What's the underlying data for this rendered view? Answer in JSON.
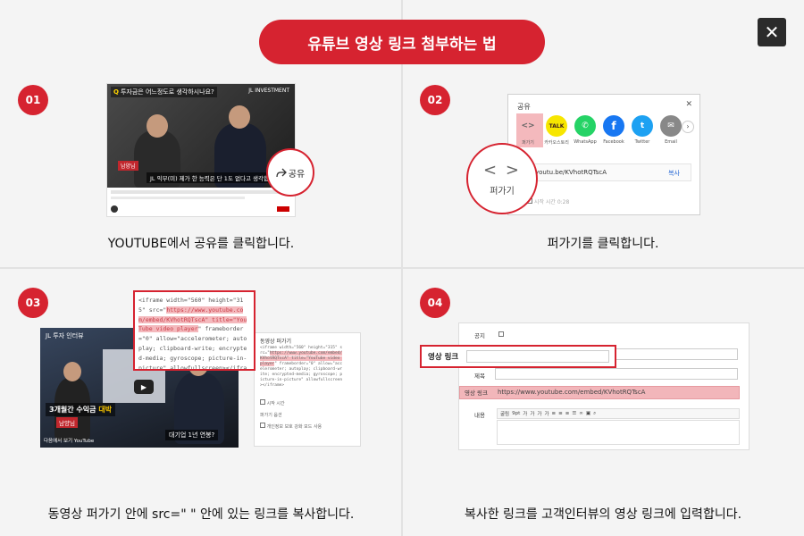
{
  "header": {
    "title": "유튜브 영상 링크 첨부하는 법"
  },
  "close_glyph": "✕",
  "steps": [
    {
      "num": "01",
      "caption": "YOUTUBE에서 공유를 클릭합니다."
    },
    {
      "num": "02",
      "caption": "퍼가기를 클릭합니다."
    },
    {
      "num": "03",
      "caption": "동영상 퍼가기 안에 src=\" \" 안에 있는 링크를 복사합니다."
    },
    {
      "num": "04",
      "caption": "복사한 링크를 고객인터뷰의 영상 링크에 입력합니다."
    }
  ],
  "step1": {
    "video_question": "투자금은 어느정도로 생각하시나요?",
    "video_brand": "JL INVESTMENT",
    "video_tag": "남양님",
    "video_subtitle": "JL 익부(미) 제가 한 능력은 단 1도 없다고 생각합니다.",
    "share_label": "공유",
    "share_icon": "share-arrow-icon"
  },
  "step2": {
    "dialog_title": "공유",
    "apps": [
      {
        "name": "퍼가기",
        "glyph": "<>",
        "color": "#ffffff",
        "fg": "#666666"
      },
      {
        "name": "카카오스토리",
        "glyph": "TALK",
        "color": "#f7e600",
        "fg": "#3a1d1d"
      },
      {
        "name": "WhatsApp",
        "glyph": "✆",
        "color": "#25d366",
        "fg": "#ffffff"
      },
      {
        "name": "Facebook",
        "glyph": "f",
        "color": "#1877f2",
        "fg": "#ffffff"
      },
      {
        "name": "Twitter",
        "glyph": "🐦",
        "color": "#1da1f2",
        "fg": "#ffffff"
      },
      {
        "name": "Email",
        "glyph": "✉",
        "color": "#888888",
        "fg": "#ffffff"
      }
    ],
    "url": "youtu.be/KVhotRQTscA",
    "copy_label": "복사",
    "start_label": "시작 시간",
    "start_value": "0:28",
    "embed_glyph": "< >",
    "embed_label": "퍼가기"
  },
  "step3": {
    "video_title": "JL 투자 인터뷰",
    "banner_main": "3개월간 수익금",
    "banner_hl": "대박",
    "video_tag": "남양님",
    "video_sub": "대기업 1년 연봉?",
    "video_footer": "다음에서 보기  YouTube",
    "panel_title": "동영상 퍼가기",
    "code_pre": "<iframe width=\"560\" height=\"315\" src=\"",
    "code_hl": "https://www.youtube.com/embed/KVhotRQTscA\" title=\"YouTube video player",
    "code_post": "\" frameborder=\"0\" allow=\"accelerometer; autoplay; clipboard-write; encrypted-media; gyroscope; picture-in-picture\" allowfullscreen></iframe>",
    "panel_start": "시작 시간",
    "panel_options": "퍼가기 옵션",
    "panel_privacy": "개인정보 보호 강화 모드 사용"
  },
  "step4": {
    "notice_label": "공지",
    "title_label": "제목",
    "link_label": "영상 링크",
    "link_value": "https://www.youtube.com/embed/KVhotRQTscA",
    "content_label": "내용",
    "toolbar_font": "굴림",
    "toolbar_size": "9pt",
    "callout_label": "영상 링크"
  }
}
